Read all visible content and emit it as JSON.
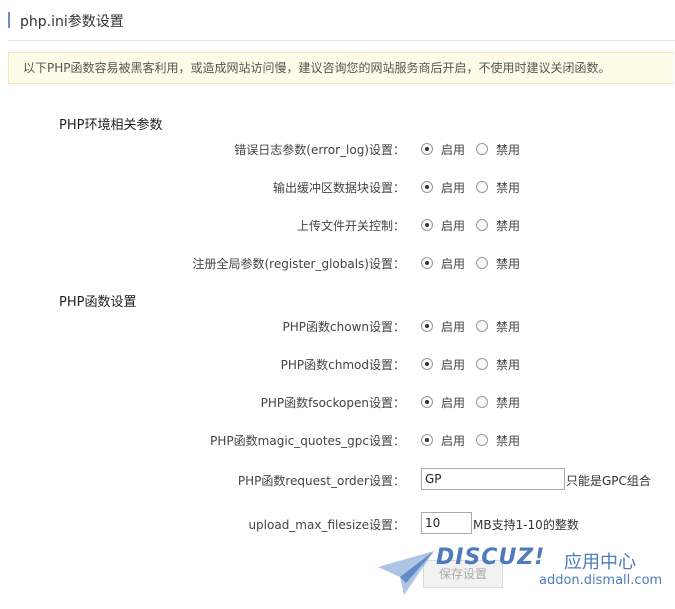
{
  "header": {
    "title": "php.ini参数设置"
  },
  "notice": "以下PHP函数容易被黑客利用，或造成网站访问慢，建议咨询您的网站服务商后开启，不使用时建议关闭函数。",
  "sections": {
    "env": {
      "title": "PHP环境相关参数",
      "rows": [
        {
          "label": "错误日志参数(error_log)设置：",
          "on": "启用",
          "off": "禁用",
          "value": "on"
        },
        {
          "label": "输出缓冲区数据块设置：",
          "on": "启用",
          "off": "禁用",
          "value": "on"
        },
        {
          "label": "上传文件开关控制：",
          "on": "启用",
          "off": "禁用",
          "value": "on"
        },
        {
          "label": "注册全局参数(register_globals)设置：",
          "on": "启用",
          "off": "禁用",
          "value": "on"
        }
      ]
    },
    "func": {
      "title": "PHP函数设置",
      "rows": [
        {
          "label": "PHP函数chown设置：",
          "on": "启用",
          "off": "禁用",
          "value": "on"
        },
        {
          "label": "PHP函数chmod设置：",
          "on": "启用",
          "off": "禁用",
          "value": "on"
        },
        {
          "label": "PHP函数fsockopen设置：",
          "on": "启用",
          "off": "禁用",
          "value": "on"
        },
        {
          "label": "PHP函数magic_quotes_gpc设置：",
          "on": "启用",
          "off": "禁用",
          "value": "on"
        }
      ]
    }
  },
  "request_order": {
    "label": "PHP函数request_order设置：",
    "value": "GP",
    "hint": "只能是GPC组合"
  },
  "upload_max": {
    "label": "upload_max_filesize设置：",
    "value": "10",
    "hint": "MB支持1-10的整数"
  },
  "save_label": "保存设置",
  "watermark": {
    "brand": "DISCUZ!",
    "cn": "应用中心",
    "url": "addon.dismall.com"
  }
}
